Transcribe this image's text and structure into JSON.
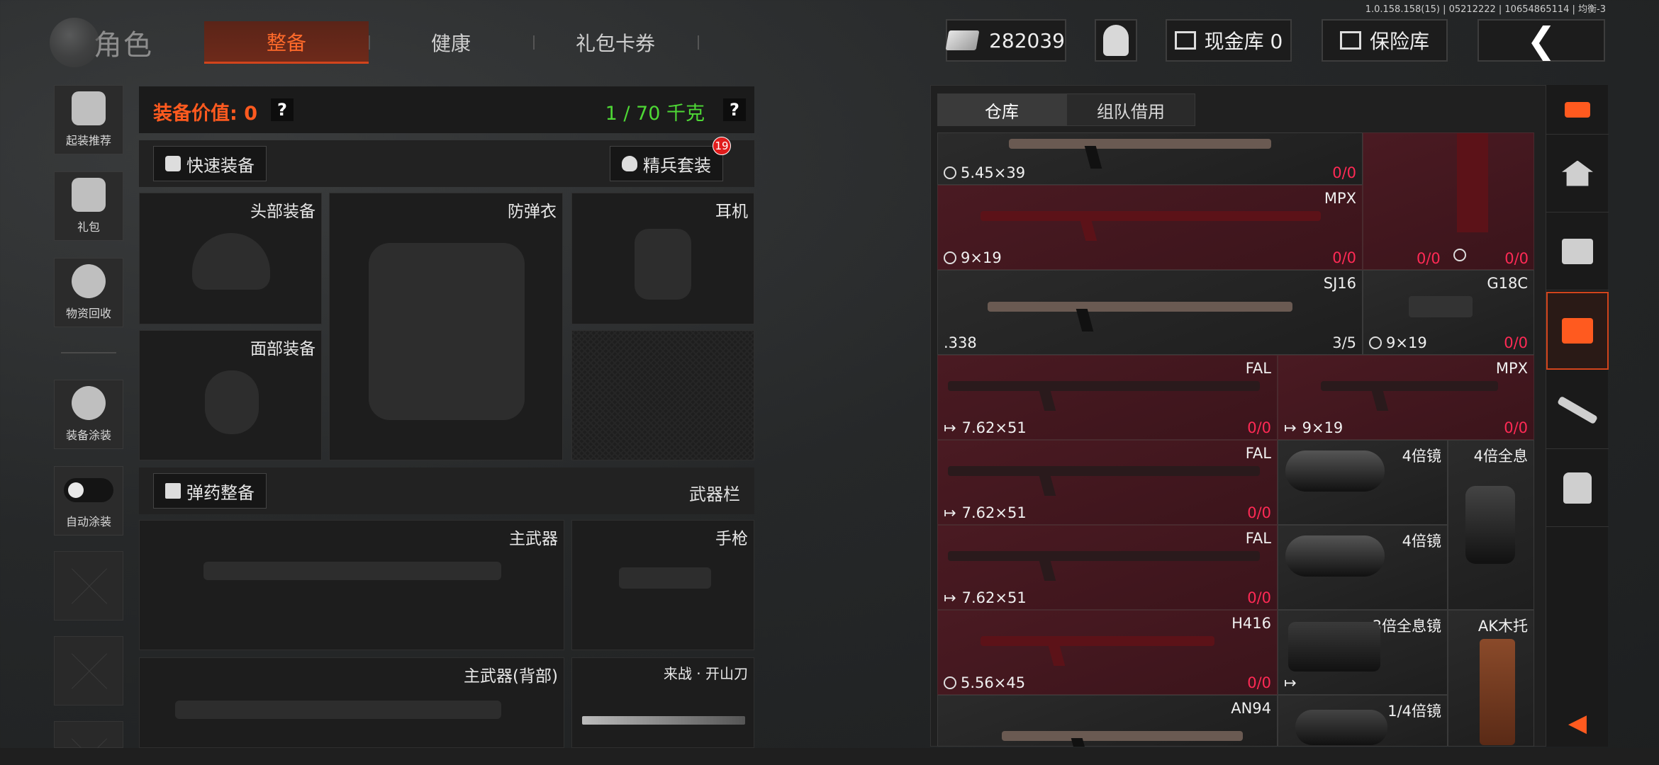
{
  "build_info": "1.0.158.158(15) | 05212222 | 10654865114 | 均衡-3",
  "header": {
    "logo_text": "角色",
    "tabs": [
      {
        "label": "整备",
        "active": true
      },
      {
        "label": "健康",
        "active": false
      },
      {
        "label": "礼包卡券",
        "active": false
      }
    ],
    "currency": "282039",
    "cash_vault": "现金库 0",
    "safe_box": "保险库"
  },
  "left_sidebar": {
    "items": [
      {
        "label": "起装推荐",
        "icon": "loadout-recommend-icon"
      },
      {
        "label": "礼包",
        "icon": "gift-icon"
      },
      {
        "label": "物资回收",
        "icon": "recycle-icon"
      },
      {
        "label": "装备涂装",
        "icon": "skin-icon"
      },
      {
        "label": "自动涂装",
        "icon": "toggle-icon"
      }
    ]
  },
  "equipment": {
    "value_label": "装备价值: 0",
    "weight_label": "1 / 70 千克",
    "help": "?",
    "quick_equip": "快速装备",
    "elite_set": "精兵套装",
    "elite_badge": "19",
    "slots": {
      "head": "头部装备",
      "armor": "防弹衣",
      "headset": "耳机",
      "face": "面部装备"
    },
    "ammo_button": "弹药整备",
    "weapon_bar": "武器栏",
    "weapon_slots": {
      "primary": "主武器",
      "pistol": "手枪",
      "primary_back": "主武器(背部)",
      "melee": "来战 · 开山刀"
    }
  },
  "warehouse": {
    "tabs": [
      {
        "label": "仓库",
        "active": true
      },
      {
        "label": "组队借用",
        "active": false
      }
    ],
    "items": [
      {
        "name": "",
        "caliber": "5.45×39",
        "count": "0/0",
        "caliber_icon": true
      },
      {
        "name": "MPX",
        "caliber": "9×19",
        "count": "0/0",
        "caliber_icon": true
      },
      {
        "name": "",
        "caliber": "",
        "count": "0/0",
        "caliber_icon": false
      },
      {
        "name": "",
        "caliber": "",
        "count": "0/0",
        "caliber_icon": true
      },
      {
        "name": "SJ16",
        "caliber": ".338",
        "count": "3/5",
        "caliber_icon": false
      },
      {
        "name": "G18C",
        "caliber": "9×19",
        "count": "0/0",
        "caliber_icon": true
      },
      {
        "name": "FAL",
        "caliber": "7.62×51",
        "count": "0/0",
        "caliber_icon": false
      },
      {
        "name": "MPX",
        "caliber": "9×19",
        "count": "0/0",
        "caliber_icon": false
      },
      {
        "name": "FAL",
        "caliber": "7.62×51",
        "count": "0/0",
        "caliber_icon": false
      },
      {
        "name": "4倍镜",
        "caliber": "",
        "count": "",
        "caliber_icon": false
      },
      {
        "name": "4倍全息",
        "caliber": "",
        "count": "",
        "caliber_icon": false
      },
      {
        "name": "FAL",
        "caliber": "7.62×51",
        "count": "0/0",
        "caliber_icon": false
      },
      {
        "name": "4倍镜",
        "caliber": "",
        "count": "",
        "caliber_icon": false
      },
      {
        "name": "H416",
        "caliber": "5.56×45",
        "count": "0/0",
        "caliber_icon": true
      },
      {
        "name": "3倍全息镜",
        "caliber": "",
        "count": "",
        "caliber_icon": false
      },
      {
        "name": "AK木托",
        "caliber": "",
        "count": "",
        "caliber_icon": false
      },
      {
        "name": "AN94",
        "caliber": "",
        "count": "",
        "caliber_icon": false
      },
      {
        "name": "1/4倍镜",
        "caliber": "",
        "count": "",
        "caliber_icon": false
      }
    ]
  },
  "right_sidebar": {
    "items": [
      {
        "icon": "sort-icon"
      },
      {
        "icon": "home-icon"
      },
      {
        "icon": "chest-icon"
      },
      {
        "icon": "storage-chest-icon",
        "active": true
      },
      {
        "icon": "rifle-icon"
      },
      {
        "icon": "armor-icon"
      },
      {
        "icon": "collapse-arrow-icon"
      }
    ]
  },
  "colors": {
    "accent": "#ff5a1f",
    "weight_green": "#4ed835",
    "count_red": "#ff2a55",
    "cell_red": "#4a1a22"
  }
}
